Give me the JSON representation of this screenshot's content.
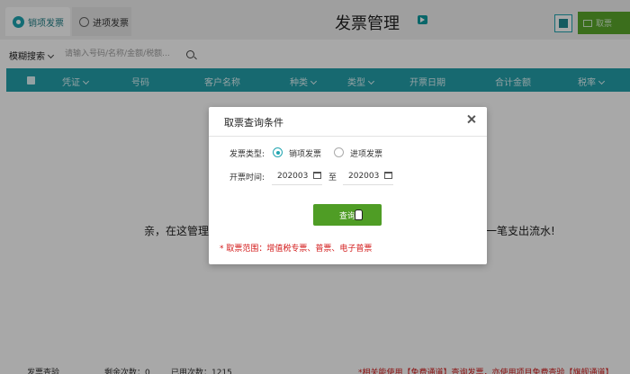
{
  "tabs": [
    {
      "label": "销项发票",
      "active": true
    },
    {
      "label": "进项发票",
      "active": false
    }
  ],
  "header": {
    "title": "发票管理",
    "get_button": "取票"
  },
  "filter": {
    "mode": "模糊搜索",
    "placeholder": "请输入号码/名称/金额/税额..."
  },
  "table": {
    "columns": [
      "凭证",
      "号码",
      "客户名称",
      "种类",
      "类型",
      "开票日期",
      "合计金额",
      "税率"
    ],
    "empty_left": "亲，在这管理",
    "empty_right": "一笔支出流水!"
  },
  "footer": {
    "left": "发票查验",
    "remain": "剩余次数：0",
    "used": "已用次数：1215",
    "promo": "*相关能使用【免费通道】查询发票，亦使用项目免费查验【旗舰通道】"
  },
  "modal": {
    "title": "取票查询条件",
    "type_label": "发票类型:",
    "type_options": [
      "销项发票",
      "进项发票"
    ],
    "selected_type": "销项发票",
    "time_label": "开票时间:",
    "start": "202003",
    "separator": "至",
    "end": "202003",
    "query_button": "查询",
    "note": "* 取票范围：增值税专票、普票、电子普票"
  },
  "colors": {
    "accent": "#23a0ab",
    "primary_button": "#4f9d25",
    "warning": "#d31b1b"
  }
}
